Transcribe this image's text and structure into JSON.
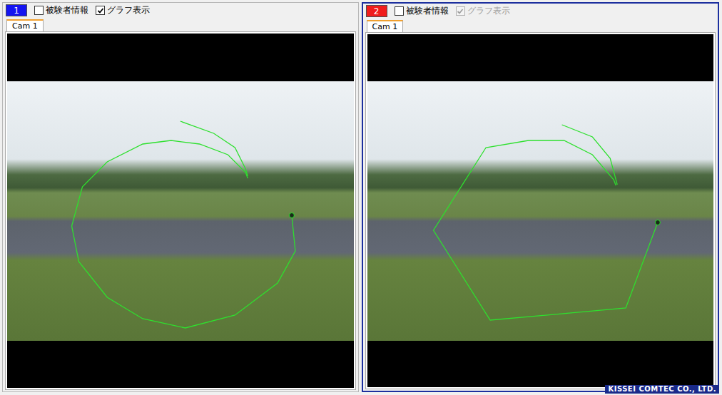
{
  "panels": [
    {
      "number": "1",
      "badge_color": "#1414f0",
      "selected": false,
      "checkboxes": [
        {
          "label": "被験者情報",
          "checked": false,
          "disabled": false
        },
        {
          "label": "グラフ表示",
          "checked": true,
          "disabled": false
        }
      ],
      "tabs": [
        {
          "label": "Cam 1",
          "selected": true
        }
      ],
      "trajectory": {
        "color": "#2ee02e",
        "paths": [
          [
            [
              401,
              188
            ],
            [
              406,
              238
            ],
            [
              381,
              283
            ],
            [
              321,
              328
            ],
            [
              251,
              346
            ],
            [
              191,
              333
            ],
            [
              141,
              303
            ],
            [
              101,
              253
            ],
            [
              91,
              203
            ],
            [
              106,
              148
            ],
            [
              141,
              113
            ],
            [
              191,
              88
            ],
            [
              231,
              83
            ],
            [
              271,
              88
            ],
            [
              311,
              103
            ],
            [
              336,
              128
            ],
            [
              339,
              136
            ]
          ],
          [
            [
              244,
              56
            ],
            [
              291,
              73
            ],
            [
              321,
              93
            ],
            [
              336,
              123
            ],
            [
              339,
              133
            ]
          ]
        ]
      }
    },
    {
      "number": "2",
      "badge_color": "#f01c1c",
      "selected": true,
      "checkboxes": [
        {
          "label": "被験者情報",
          "checked": false,
          "disabled": false
        },
        {
          "label": "グラフ表示",
          "checked": true,
          "disabled": true
        }
      ],
      "tabs": [
        {
          "label": "Cam 1",
          "selected": true
        }
      ],
      "trajectory": {
        "color": "#2ee02e",
        "paths": [
          [
            [
              409,
              198
            ],
            [
              364,
              318
            ],
            [
              173,
              335
            ],
            [
              93,
              209
            ],
            [
              167,
              93
            ],
            [
              227,
              83
            ],
            [
              277,
              83
            ],
            [
              317,
              103
            ],
            [
              347,
              138
            ],
            [
              350,
              146
            ]
          ],
          [
            [
              274,
              61
            ],
            [
              317,
              78
            ],
            [
              342,
              108
            ],
            [
              352,
              145
            ]
          ]
        ]
      }
    }
  ],
  "watermark": "KISSEI COMTEC CO., LTD."
}
